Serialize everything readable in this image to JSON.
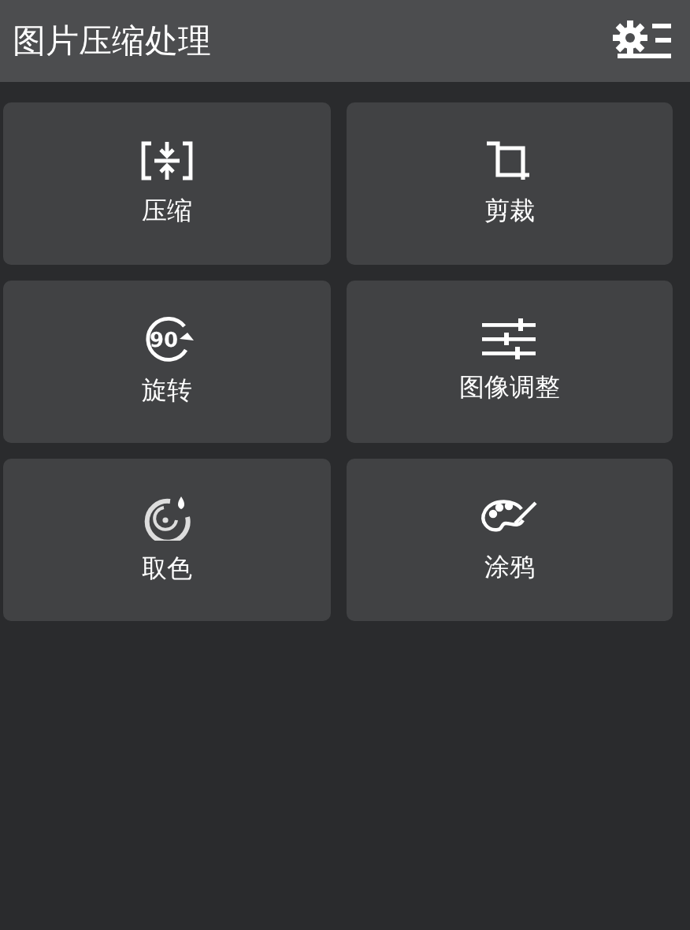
{
  "header": {
    "title": "图片压缩处理"
  },
  "tools": [
    {
      "kind": "compress",
      "label": "压缩"
    },
    {
      "kind": "crop",
      "label": "剪裁"
    },
    {
      "kind": "rotate",
      "label": "旋转",
      "icon_text": "90"
    },
    {
      "kind": "adjust",
      "label": "图像调整"
    },
    {
      "kind": "color_pick",
      "label": "取色"
    },
    {
      "kind": "paint",
      "label": "涂鸦"
    }
  ]
}
